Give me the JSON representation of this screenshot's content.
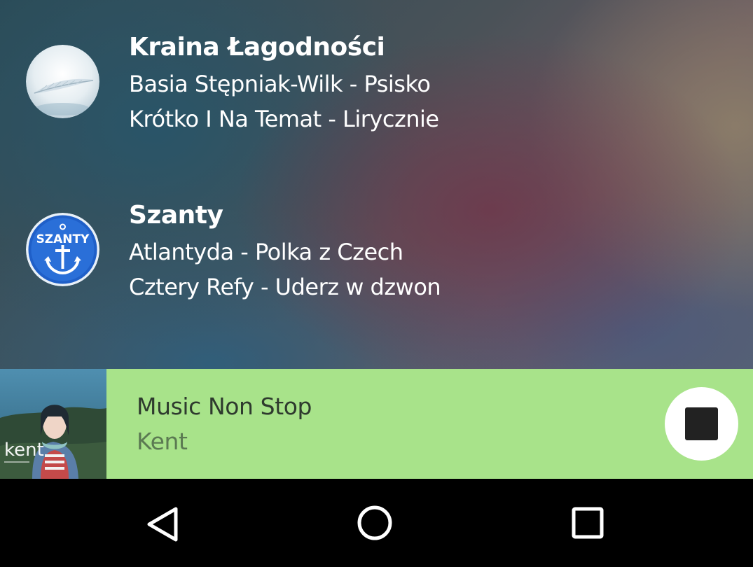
{
  "stations": [
    {
      "name": "Kraina Łagodności",
      "logo_icon": "feather-icon",
      "tracks": [
        "Basia Stępniak-Wilk - Psisko",
        "Krótko I Na Temat - Lirycznie"
      ]
    },
    {
      "name": "Szanty",
      "logo_icon": "anchor-icon",
      "logo_text": "SZANTY",
      "tracks": [
        "Atlantyda - Polka z Czech",
        "Cztery Refy - Uderz w dzwon"
      ]
    }
  ],
  "now_playing": {
    "title": "Music Non Stop",
    "artist": "Kent",
    "cover_text": "kent",
    "cover_icon": "album-cover-icon",
    "control_icon": "stop-icon",
    "accent_color": "#a8e38a"
  },
  "navbar": {
    "back_icon": "back-triangle-icon",
    "home_icon": "home-circle-icon",
    "recents_icon": "recents-square-icon"
  }
}
